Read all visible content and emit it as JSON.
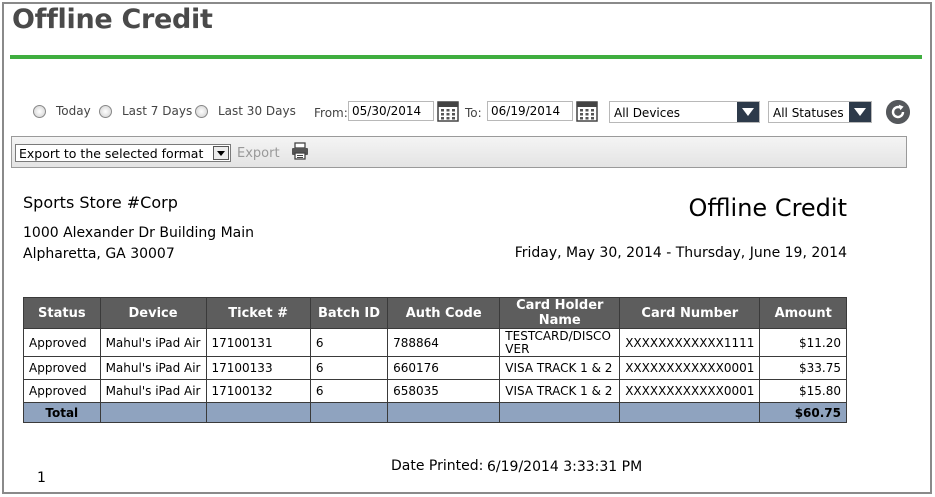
{
  "page": {
    "title": "Offline Credit"
  },
  "filters": {
    "radios": [
      {
        "label": "Today"
      },
      {
        "label": "Last 7 Days"
      },
      {
        "label": "Last 30 Days"
      }
    ],
    "from_label": "From:",
    "from_value": "05/30/2014",
    "to_label": "To:",
    "to_value": "06/19/2014",
    "device_select": "All Devices",
    "status_select": "All Statuses"
  },
  "toolbar": {
    "export_format": "Export to the selected format",
    "export_label": "Export"
  },
  "report": {
    "company": "Sports Store #Corp",
    "address_line1": "1000 Alexander Dr Building Main",
    "address_line2": "Alpharetta, GA 30007",
    "title": "Offline Credit",
    "date_range": "Friday, May 30, 2014 - Thursday, June 19, 2014",
    "columns": [
      "Status",
      "Device",
      "Ticket #",
      "Batch ID",
      "Auth Code",
      "Card Holder Name",
      "Card Number",
      "Amount"
    ],
    "rows": [
      [
        "Approved",
        "Mahul's iPad Air",
        "17100131",
        "6",
        "788864",
        "TESTCARD/DISCOVER",
        "XXXXXXXXXXXX1111",
        "$11.20"
      ],
      [
        "Approved",
        "Mahul's iPad Air",
        "17100133",
        "6",
        "660176",
        "VISA TRACK 1 & 2",
        "XXXXXXXXXXXX0001",
        "$33.75"
      ],
      [
        "Approved",
        "Mahul's iPad Air",
        "17100132",
        "6",
        "658035",
        "VISA TRACK 1 & 2",
        "XXXXXXXXXXXX0001",
        "$15.80"
      ]
    ],
    "total_label": "Total",
    "total_amount": "$60.75",
    "date_printed_label": "Date Printed:",
    "date_printed_value": "6/19/2014 3:33:31 PM",
    "page_number": "1"
  }
}
